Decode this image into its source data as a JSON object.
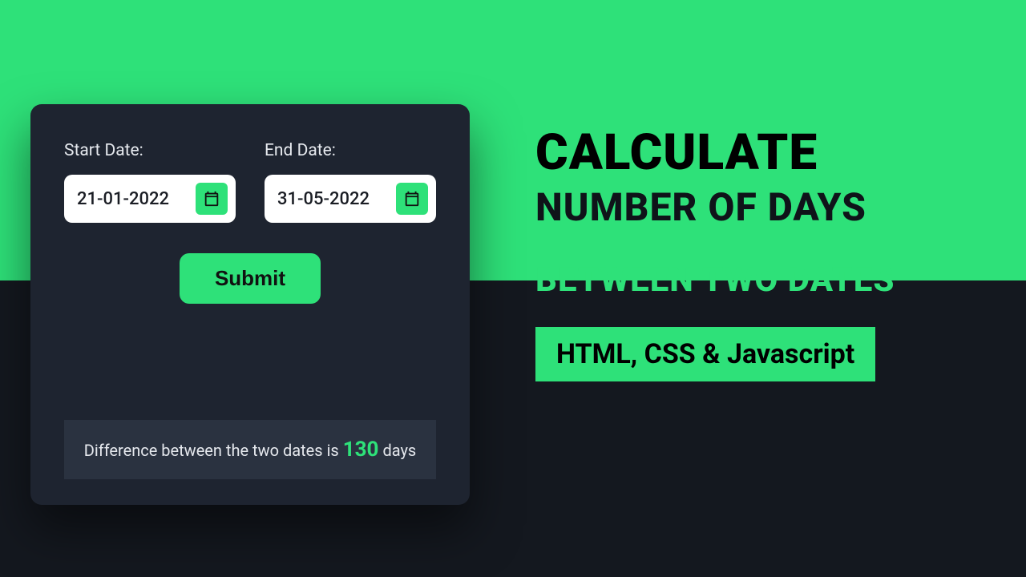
{
  "form": {
    "start_label": "Start Date:",
    "end_label": "End Date:",
    "start_value": "21-01-2022",
    "end_value": "31-05-2022",
    "submit_label": "Submit",
    "result_prefix": "Difference between the two dates is ",
    "result_value": "130",
    "result_suffix": " days"
  },
  "headline": {
    "line1": "CALCULATE",
    "line2": "NUMBER OF DAYS",
    "line3": "BETWEEN TWO DATES",
    "badge": "HTML, CSS & Javascript"
  },
  "colors": {
    "accent": "#2ee179",
    "dark": "#14181f",
    "card": "#1e2430"
  }
}
